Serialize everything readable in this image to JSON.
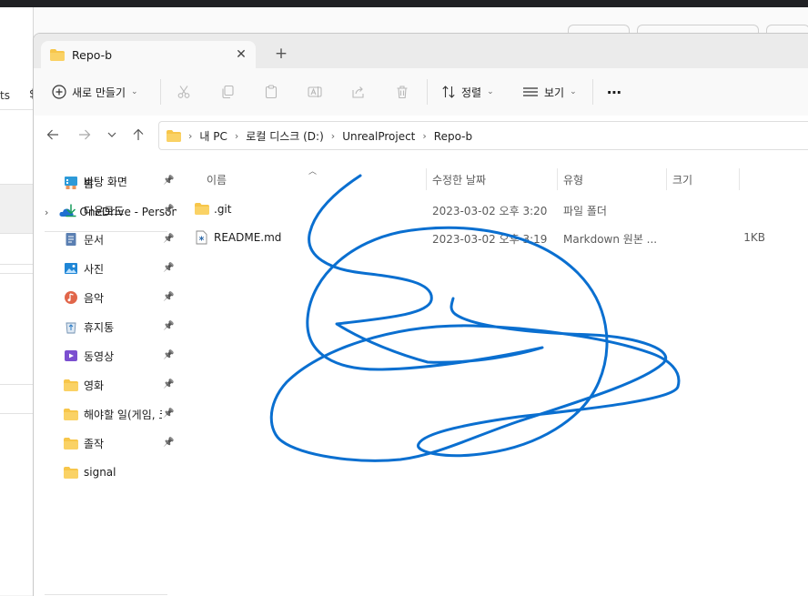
{
  "colors": {
    "scribble": "#0a6fd0",
    "folder": "#f7c64a",
    "accent": "#0067c0"
  },
  "background": {
    "left_text": "ts",
    "left_glyph": "$"
  },
  "tab": {
    "title": "Repo-b",
    "close_icon": "close-icon",
    "new_tab_icon": "plus-icon"
  },
  "toolbar": {
    "new_label": "새로 만들기",
    "sort_label": "정렬",
    "view_label": "보기",
    "more_label": "⋯"
  },
  "breadcrumb": [
    "내 PC",
    "로컬 디스크 (D:)",
    "UnrealProject",
    "Repo-b"
  ],
  "sidebar": {
    "home": "홈",
    "onedrive": "OneDrive - Personal",
    "quick": [
      {
        "label": "바탕 화면",
        "icon": "desktop-icon"
      },
      {
        "label": "다운로드",
        "icon": "download-icon"
      },
      {
        "label": "문서",
        "icon": "document-icon"
      },
      {
        "label": "사진",
        "icon": "pictures-icon"
      },
      {
        "label": "음악",
        "icon": "music-icon"
      },
      {
        "label": "휴지통",
        "icon": "recycle-bin-icon"
      },
      {
        "label": "동영상",
        "icon": "video-icon"
      },
      {
        "label": "영화",
        "icon": "folder-icon"
      },
      {
        "label": "해야할 일(게임, 코",
        "icon": "folder-icon"
      },
      {
        "label": "졸작",
        "icon": "folder-icon"
      },
      {
        "label": "signal",
        "icon": "folder-icon"
      }
    ]
  },
  "columns": {
    "name": "이름",
    "modified": "수정한 날짜",
    "type": "유형",
    "size": "크기"
  },
  "files": [
    {
      "name": ".git",
      "modified": "2023-03-02 오후 3:20",
      "type": "파일 폴더",
      "size": ""
    },
    {
      "name": "README.md",
      "modified": "2023-03-02 오후 3:19",
      "type": "Markdown 원본 ...",
      "size": "1KB"
    }
  ]
}
